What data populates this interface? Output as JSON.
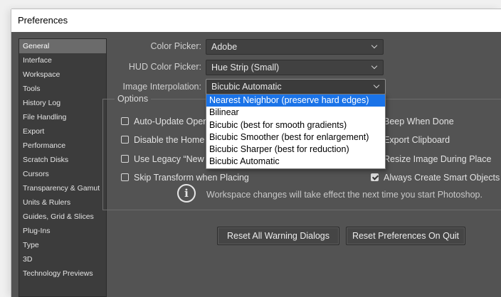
{
  "window": {
    "title": "Preferences"
  },
  "sidebar": {
    "items": [
      {
        "label": "General"
      },
      {
        "label": "Interface"
      },
      {
        "label": "Workspace"
      },
      {
        "label": "Tools"
      },
      {
        "label": "History Log"
      },
      {
        "label": "File Handling"
      },
      {
        "label": "Export"
      },
      {
        "label": "Performance"
      },
      {
        "label": "Scratch Disks"
      },
      {
        "label": "Cursors"
      },
      {
        "label": "Transparency & Gamut"
      },
      {
        "label": "Units & Rulers"
      },
      {
        "label": "Guides, Grid & Slices"
      },
      {
        "label": "Plug-Ins"
      },
      {
        "label": "Type"
      },
      {
        "label": "3D"
      },
      {
        "label": "Technology Previews"
      }
    ],
    "selected": "General"
  },
  "fields": {
    "color_picker": {
      "label": "Color Picker:",
      "value": "Adobe"
    },
    "hud_color_picker": {
      "label": "HUD Color Picker:",
      "value": "Hue Strip (Small)"
    },
    "image_interpolation": {
      "label": "Image Interpolation:",
      "value": "Bicubic Automatic"
    }
  },
  "interpolation_dropdown": {
    "options": [
      "Nearest Neighbor (preserve hard edges)",
      "Bilinear",
      "Bicubic (best for smooth gradients)",
      "Bicubic Smoother (best for enlargement)",
      "Bicubic Sharper (best for reduction)",
      "Bicubic Automatic"
    ],
    "highlighted": "Nearest Neighbor (preserve hard edges)"
  },
  "options": {
    "legend": "Options",
    "left": [
      {
        "label": "Auto-Update Oper",
        "checked": false
      },
      {
        "label": "Disable the Home",
        "checked": false
      },
      {
        "label": "Use Legacy “New",
        "checked": false
      },
      {
        "label": "Skip Transform when Placing",
        "checked": false
      }
    ],
    "right": [
      {
        "label": "Beep When Done",
        "checked": false
      },
      {
        "label": "Export Clipboard",
        "checked": false
      },
      {
        "label": "Resize Image During Place",
        "checked": false
      },
      {
        "label": "Always Create Smart Objects w",
        "checked": true
      }
    ],
    "info_icon": "info-circle-icon",
    "info_text": "Workspace changes will take effect the next time you start Photoshop."
  },
  "buttons": {
    "reset_warnings": "Reset All Warning Dialogs",
    "reset_prefs": "Reset Preferences On Quit"
  },
  "colors": {
    "panel": "#535353",
    "sidebar": "#3c3c3c",
    "selected_item": "#6b6b6b",
    "dropdown_highlight": "#1a73e8"
  }
}
